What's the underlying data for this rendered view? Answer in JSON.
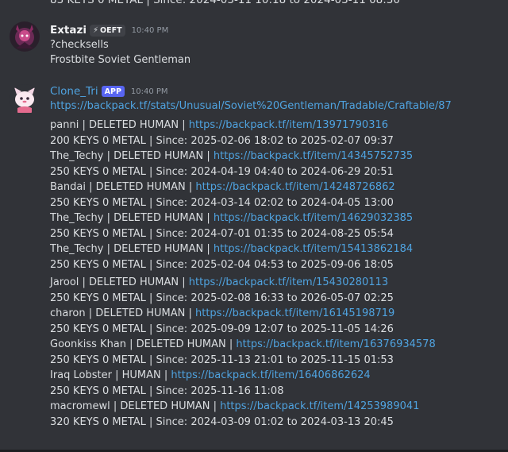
{
  "top_cut_text": "83 KEYS 0 METAL | Since: 2024-03-11 10:18 to 2024-03-11 08:30",
  "messages": [
    {
      "username": "Extazi",
      "tag": "OEFT",
      "time": "10:40 PM",
      "lines": [
        "?checksells",
        "Frostbite Soviet Gentleman"
      ]
    },
    {
      "username": "Clone_Tri",
      "app_tag": "APP",
      "time": "10:40 PM",
      "stats_link": "https://backpack.tf/stats/Unusual/Soviet%20Gentleman/Tradable/Craftable/87",
      "entries": [
        {
          "owner": "panni | DELETED HUMAN | ",
          "link": "https://backpack.tf/item/13971790316",
          "price": "200 KEYS 0 METAL | Since: 2025-02-06 18:02 to 2025-02-07 09:37"
        },
        {
          "owner": "The_Techy | DELETED HUMAN | ",
          "link": "https://backpack.tf/item/14345752735",
          "price": "250 KEYS 0 METAL | Since: 2024-04-19 04:40 to 2024-06-29 20:51"
        },
        {
          "owner": "Bandai | DELETED HUMAN | ",
          "link": "https://backpack.tf/item/14248726862",
          "price": "250 KEYS 0 METAL | Since: 2024-03-14 02:02 to 2024-04-05 13:00"
        },
        {
          "owner": "The_Techy | DELETED HUMAN | ",
          "link": "https://backpack.tf/item/14629032385",
          "price": "250 KEYS 0 METAL | Since: 2024-07-01 01:35 to 2024-08-25 05:54"
        },
        {
          "owner": "The_Techy | DELETED HUMAN | ",
          "link": "https://backpack.tf/item/15413862184",
          "price": "250 KEYS 0 METAL | Since: 2025-02-04 04:53 to 2025-09-06 18:05"
        },
        {
          "owner": "Jarool | DELETED HUMAN | ",
          "link": "https://backpack.tf/item/15430280113",
          "price": "250 KEYS 0 METAL | Since: 2025-02-08 16:33 to 2026-05-07 02:25"
        },
        {
          "owner": "charon | DELETED HUMAN | ",
          "link": "https://backpack.tf/item/16145198719",
          "price": "250 KEYS 0 METAL | Since: 2025-09-09 12:07 to 2025-11-05 14:26"
        },
        {
          "owner": "Goonkiss Khan | DELETED HUMAN | ",
          "link": "https://backpack.tf/item/16376934578",
          "price": "250 KEYS 0 METAL | Since: 2025-11-13 21:01 to 2025-11-15 01:53"
        },
        {
          "owner": "Iraq Lobster | HUMAN | ",
          "link": "https://backpack.tf/item/16406862624",
          "price": "250 KEYS 0 METAL | Since: 2025-11-16 11:08"
        },
        {
          "owner": "macromewl | DELETED HUMAN | ",
          "link": "https://backpack.tf/item/14253989041",
          "price": "320 KEYS 0 METAL | Since: 2024-03-09 01:02 to 2024-03-13 20:45"
        }
      ]
    }
  ]
}
